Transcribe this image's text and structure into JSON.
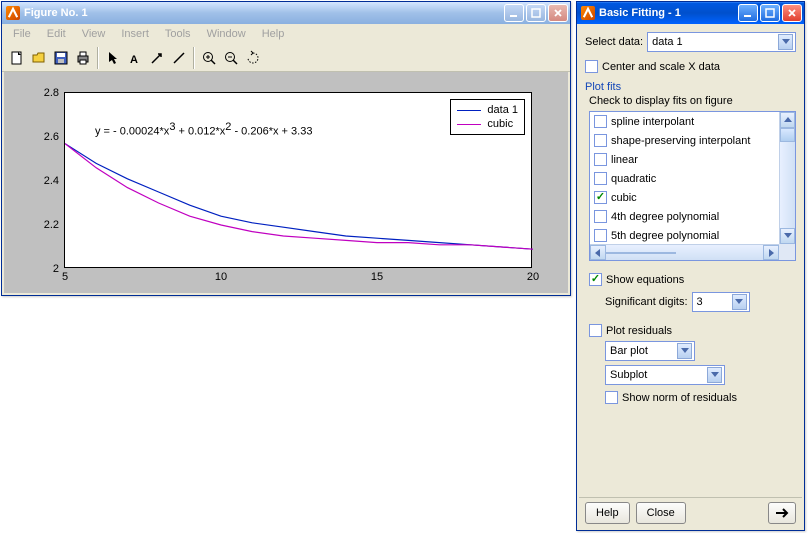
{
  "figureWindow": {
    "title": "Figure No. 1",
    "menus": [
      "File",
      "Edit",
      "View",
      "Insert",
      "Tools",
      "Window",
      "Help"
    ]
  },
  "fitWindow": {
    "title": "Basic Fitting - 1",
    "selectDataLabel": "Select data:",
    "selectDataValue": "data 1",
    "centerScaleLabel": "Center and scale X data",
    "plotFitsLabel": "Plot fits",
    "checkDisplayLabel": "Check to display fits on figure",
    "fitOptions": [
      {
        "label": "spline interpolant",
        "checked": false
      },
      {
        "label": "shape-preserving interpolant",
        "checked": false
      },
      {
        "label": "linear",
        "checked": false
      },
      {
        "label": "quadratic",
        "checked": false
      },
      {
        "label": "cubic",
        "checked": true
      },
      {
        "label": "4th degree polynomial",
        "checked": false
      },
      {
        "label": "5th degree polynomial",
        "checked": false
      }
    ],
    "showEquationsLabel": "Show equations",
    "sigDigitsLabel": "Significant digits:",
    "sigDigitsValue": "3",
    "plotResidualsLabel": "Plot residuals",
    "residualType": "Bar plot",
    "residualPlace": "Subplot",
    "showNormLabel": "Show norm of residuals",
    "helpLabel": "Help",
    "closeLabel": "Close"
  },
  "chart_data": {
    "type": "line",
    "x": [
      5,
      6,
      7,
      8,
      9,
      10,
      11,
      12,
      13,
      14,
      15,
      16,
      17,
      18,
      19,
      20
    ],
    "series": [
      {
        "name": "data 1",
        "color": "#0020c0",
        "values": [
          2.57,
          2.48,
          2.41,
          2.35,
          2.29,
          2.24,
          2.21,
          2.19,
          2.17,
          2.15,
          2.14,
          2.13,
          2.12,
          2.11,
          2.1,
          2.09
        ]
      },
      {
        "name": "cubic",
        "color": "#c000c0",
        "values": [
          2.57,
          2.46,
          2.37,
          2.3,
          2.24,
          2.2,
          2.17,
          2.15,
          2.14,
          2.13,
          2.12,
          2.12,
          2.11,
          2.11,
          2.1,
          2.09
        ]
      }
    ],
    "equation": "y = - 0.00024*x³ + 0.012*x² - 0.206*x + 3.33",
    "equation_plain": "y = - 0.00024*x^3 + 0.012*x^2 - 0.206*x + 3.33",
    "xlim": [
      5,
      20
    ],
    "ylim": [
      2,
      2.8
    ],
    "xticks": [
      5,
      10,
      15,
      20
    ],
    "yticks": [
      2,
      2.2,
      2.4,
      2.6,
      2.8
    ],
    "xlabel": "",
    "ylabel": "",
    "title": ""
  }
}
